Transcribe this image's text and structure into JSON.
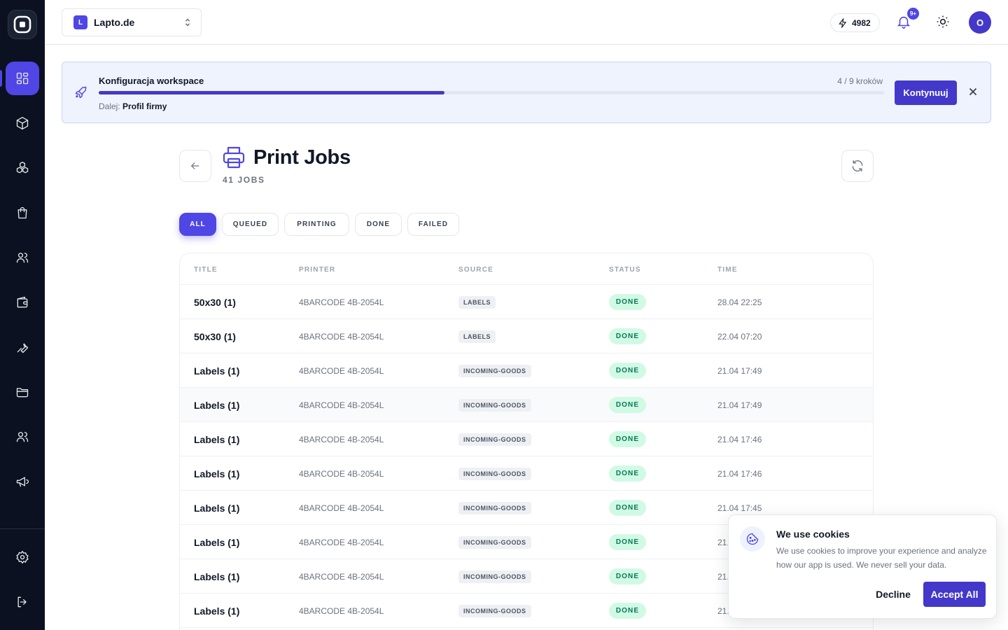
{
  "workspace": {
    "badge": "L",
    "name": "Lapto.de"
  },
  "topbar": {
    "credits": "4982",
    "notifications_badge": "9+",
    "avatar_initial": "O"
  },
  "banner": {
    "title": "Konfiguracja workspace",
    "steps": "4 / 9 kroków",
    "progress": 0.44,
    "next_label": "Dalej:",
    "next_value": "Profil firmy",
    "continue_label": "Kontynuuj"
  },
  "page": {
    "title": "Print Jobs",
    "count": "41 JOBS"
  },
  "tabs": [
    {
      "label": "ALL",
      "active": true
    },
    {
      "label": "QUEUED",
      "active": false
    },
    {
      "label": "PRINTING",
      "active": false
    },
    {
      "label": "DONE",
      "active": false
    },
    {
      "label": "FAILED",
      "active": false
    }
  ],
  "table": {
    "columns": [
      "TITLE",
      "PRINTER",
      "SOURCE",
      "STATUS",
      "TIME"
    ],
    "rows": [
      {
        "title": "50x30 (1)",
        "printer": "4BARCODE 4B-2054L",
        "source": "LABELS",
        "status": "DONE",
        "time": "28.04 22:25"
      },
      {
        "title": "50x30 (1)",
        "printer": "4BARCODE 4B-2054L",
        "source": "LABELS",
        "status": "DONE",
        "time": "22.04 07:20"
      },
      {
        "title": "Labels (1)",
        "printer": "4BARCODE 4B-2054L",
        "source": "INCOMING-GOODS",
        "status": "DONE",
        "time": "21.04 17:49"
      },
      {
        "title": "Labels (1)",
        "printer": "4BARCODE 4B-2054L",
        "source": "INCOMING-GOODS",
        "status": "DONE",
        "time": "21.04 17:49"
      },
      {
        "title": "Labels (1)",
        "printer": "4BARCODE 4B-2054L",
        "source": "INCOMING-GOODS",
        "status": "DONE",
        "time": "21.04 17:46"
      },
      {
        "title": "Labels (1)",
        "printer": "4BARCODE 4B-2054L",
        "source": "INCOMING-GOODS",
        "status": "DONE",
        "time": "21.04 17:46"
      },
      {
        "title": "Labels (1)",
        "printer": "4BARCODE 4B-2054L",
        "source": "INCOMING-GOODS",
        "status": "DONE",
        "time": "21.04 17:45"
      },
      {
        "title": "Labels (1)",
        "printer": "4BARCODE 4B-2054L",
        "source": "INCOMING-GOODS",
        "status": "DONE",
        "time": "21."
      },
      {
        "title": "Labels (1)",
        "printer": "4BARCODE 4B-2054L",
        "source": "INCOMING-GOODS",
        "status": "DONE",
        "time": "21."
      },
      {
        "title": "Labels (1)",
        "printer": "4BARCODE 4B-2054L",
        "source": "INCOMING-GOODS",
        "status": "DONE",
        "time": "21."
      }
    ]
  },
  "cookie": {
    "title": "We use cookies",
    "text": "We use cookies to improve your experience and analyze how our app is used. We never sell your data.",
    "decline_label": "Decline",
    "accept_label": "Accept All"
  },
  "colors": {
    "accent": "#4f46e5",
    "sidebar": "#0b1120",
    "status_done_bg": "#d1fae5",
    "status_done_text": "#047857"
  },
  "sidebar_icons": [
    "dashboard-icon",
    "box-icon",
    "boxes-icon",
    "shopping-bag-icon",
    "users-icon",
    "wallet-icon",
    "wrench-icon",
    "folder-icon",
    "users-icon",
    "megaphone-icon",
    "settings-icon",
    "logout-icon"
  ]
}
